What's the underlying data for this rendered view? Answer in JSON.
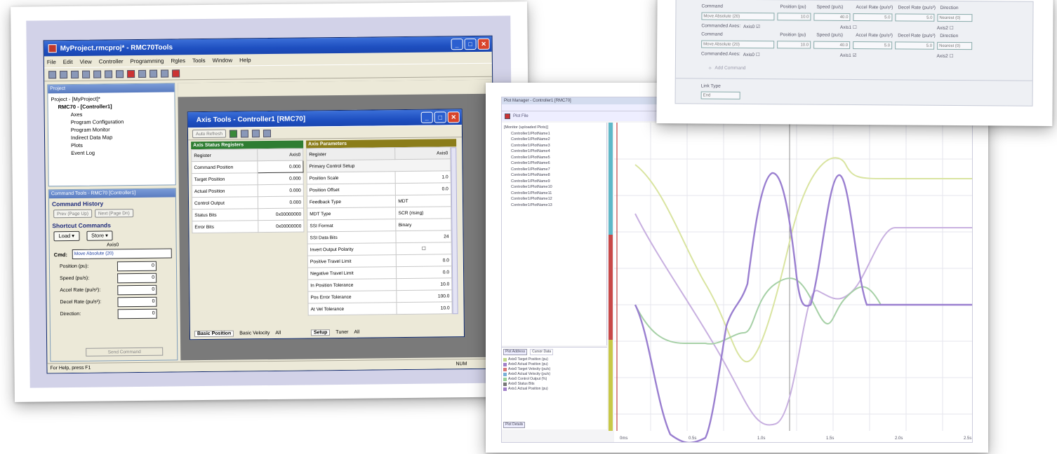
{
  "main_window": {
    "title": "MyProject.rmcproj* - RMC70Tools",
    "menu": [
      "File",
      "Edit",
      "View",
      "Controller",
      "Programming",
      "Rgles",
      "Tools",
      "Window",
      "Help"
    ],
    "status_left": "For Help, press F1",
    "status_right": "NUM"
  },
  "project_tree": {
    "header": "Project",
    "items": [
      "Project - [MyProject]*",
      "RMC70 - [Controller1]",
      "Axes",
      "Program Configuration",
      "Program Monitor",
      "Indirect Data Map",
      "Plots",
      "Event Log"
    ]
  },
  "command_tools": {
    "header": "Command Tools - RMC70 [Controller1]",
    "history_title": "Command History",
    "prev_btn": "Prev (Page Up)",
    "next_btn": "Next (Page Dn)",
    "shortcut_title": "Shortcut Commands",
    "load_btn": "Load",
    "store_btn": "Store",
    "axis_label": "Axis0",
    "cmd_label": "Cmd:",
    "cmd_value": "Move Absolute (20)",
    "fields": [
      {
        "label": "Position (pu):",
        "value": "0"
      },
      {
        "label": "Speed (pu/s):",
        "value": "0"
      },
      {
        "label": "Accel Rate (pu/s²):",
        "value": "0"
      },
      {
        "label": "Decel Rate (pu/s²):",
        "value": "0"
      },
      {
        "label": "Direction:",
        "value": "0"
      }
    ],
    "send_btn": "Send Command"
  },
  "axis_tools": {
    "title": "Axis Tools - Controller1 [RMC70]",
    "auto_refresh": "Auto Refresh",
    "status_header": "Axis Status Registers",
    "params_header": "Axis Parameters",
    "col_register": "Register",
    "col_axis": "Axis0",
    "status_rows": [
      [
        "Command Position",
        "0.000"
      ],
      [
        "Target Position",
        "0.000"
      ],
      [
        "Actual Position",
        "0.000"
      ],
      [
        "Control Output",
        "0.000"
      ],
      [
        "Status Bits",
        "0x00000000"
      ],
      [
        "Error Bits",
        "0x00000000"
      ]
    ],
    "param_group": "Primary Control Setup",
    "param_rows": [
      [
        "Position Scale",
        "1.0"
      ],
      [
        "Position Offset",
        "0.0"
      ],
      [
        "Feedback Type",
        "MDT"
      ],
      [
        "MDT Type",
        "SCR (rising)"
      ],
      [
        "SSI Format",
        "Binary"
      ],
      [
        "SSI Data Bits",
        "24"
      ],
      [
        "Invert Output Polarity",
        ""
      ],
      [
        "Positive Travel Limit",
        "0.0"
      ],
      [
        "Negative Travel Limit",
        "0.0"
      ],
      [
        "In Position Tolerance",
        "10.0"
      ],
      [
        "Pos Error Tolerance",
        "100.0"
      ],
      [
        "At Vel Tolerance",
        "10.0"
      ]
    ],
    "left_tabs": [
      "Basic Position",
      "Basic Velocity",
      "All"
    ],
    "right_tabs": [
      "Setup",
      "Tuner",
      "All"
    ]
  },
  "command_card": {
    "row_labels": [
      "Command",
      "Position (pu)",
      "Speed (pu/s)",
      "Accel Rate (pu/s²)",
      "Decel Rate (pu/s²)",
      "Direction"
    ],
    "rows": [
      {
        "cmd": "Move Absolute (20)",
        "pos": "10.0",
        "spd": "40.0",
        "acc": "5.0",
        "dec": "5.0",
        "dir": "Nearest (0)"
      },
      {
        "cmd": "Move Absolute (20)",
        "pos": "10.0",
        "spd": "40.0",
        "acc": "5.0",
        "dec": "5.0",
        "dir": "Nearest (0)"
      }
    ],
    "commanded_axes": "Commanded Axes:",
    "axis0": "Axis0",
    "axis1": "Axis1",
    "axis2": "Axis2",
    "add_command": "Add Command",
    "link_type": "Link Type",
    "link_value": "End"
  },
  "plot_card": {
    "title": "Plot Manager - Controller1 [RMC70]",
    "plot_tab": "Plot File",
    "tree_root": "[Monitor (uploaded Plots)]",
    "items": [
      "Controller1/PlotName1",
      "Controller1/PlotName2",
      "Controller1/PlotName3",
      "Controller1/PlotName4",
      "Controller1/PlotName5",
      "Controller1/PlotName6",
      "Controller1/PlotName7",
      "Controller1/PlotName8",
      "Controller1/PlotName9",
      "Controller1/PlotName10",
      "Controller1/PlotName11",
      "Controller1/PlotName12",
      "Controller1/PlotName13"
    ],
    "legend_tab1": "Plot Address",
    "legend_tab2": "Cursor Data",
    "legend_tab3": "Plot Details",
    "legend_items": [
      {
        "name": "Axis0 Target Position (pu)",
        "color": "#c0d88a"
      },
      {
        "name": "Axis0 Actual Position (pu)",
        "color": "#a080c8"
      },
      {
        "name": "Axis0 Target Velocity (pu/s)",
        "color": "#d87878"
      },
      {
        "name": "Axis0 Actual Velocity (pu/s)",
        "color": "#7ab0d8"
      },
      {
        "name": "Axis0 Control Output (%)",
        "color": "#9ad09a"
      },
      {
        "name": "Axis0 Status Bits",
        "color": "#777777"
      },
      {
        "name": "Axis1 Actual Position (pu)",
        "color": "#a080c8"
      }
    ],
    "x_ticks": [
      "0ms",
      "0.5s",
      "1.0s",
      "1.5s",
      "2.0s",
      "2.5s"
    ],
    "series_colors": {
      "a": "#9a7fd0",
      "b": "#7fbf7f",
      "c": "#c88ad8",
      "d": "#d9e4a0",
      "e": "#b89ad0"
    }
  }
}
